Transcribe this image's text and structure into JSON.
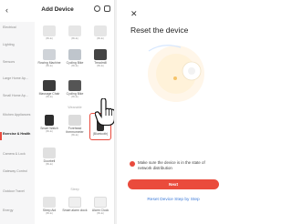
{
  "left_panel": {
    "header": {
      "back_icon": "chevron-left-icon",
      "title": "Add Device"
    },
    "categories": [
      {
        "label": "Electrical"
      },
      {
        "label": "Lighting"
      },
      {
        "label": "Sensors"
      },
      {
        "label": "Large Home Ap..."
      },
      {
        "label": "Small Home Ap..."
      },
      {
        "label": "Kitchen Appliances"
      },
      {
        "label": "Exercise & Health",
        "active": true
      },
      {
        "label": "Camera & Lock"
      },
      {
        "label": "Gateway Control"
      },
      {
        "label": "Outdoor Travel"
      },
      {
        "label": "Energy"
      }
    ],
    "devices": [
      {
        "name": "",
        "sub": "(BLE)"
      },
      {
        "name": "",
        "sub": "(BLE)"
      },
      {
        "name": "",
        "sub": "(BLE)"
      },
      {
        "name": "Rowing Machine",
        "sub": "(BLE)"
      },
      {
        "name": "Cycling Bike",
        "sub": "(BLE)"
      },
      {
        "name": "",
        "sub": "(BLE)"
      },
      {
        "name": "Treadmill",
        "sub": "(BLE)"
      },
      {
        "name": "Massage Chair",
        "sub": "(BLE)"
      },
      {
        "name": "Cycling Bike",
        "sub": "(BLE)"
      },
      {
        "name": "Smart Watch",
        "sub": "(BLE)"
      },
      {
        "name": "Forehead thermometer",
        "sub": "(BLE)"
      },
      {
        "name": "(Bluetooth)",
        "sub": ""
      },
      {
        "name": "Doorbell",
        "sub": "(BLE)"
      },
      {
        "name": "Sleep Aid",
        "sub": "(BLE)"
      },
      {
        "name": "Smart alarm clock",
        "sub": ""
      },
      {
        "name": "Alarm Clock",
        "sub": "(BLE)"
      }
    ],
    "section_labels": [
      "Wearable",
      "Sleep"
    ]
  },
  "right_panel": {
    "close_icon": "close-icon",
    "title": "Reset the device",
    "confirm_text": "Make sure the device is in the state of network distribution",
    "next_label": "Next",
    "reset_link": "Reset Device Step by Step"
  },
  "colors": {
    "accent": "#e84a3d",
    "link": "#3d7bd9"
  }
}
